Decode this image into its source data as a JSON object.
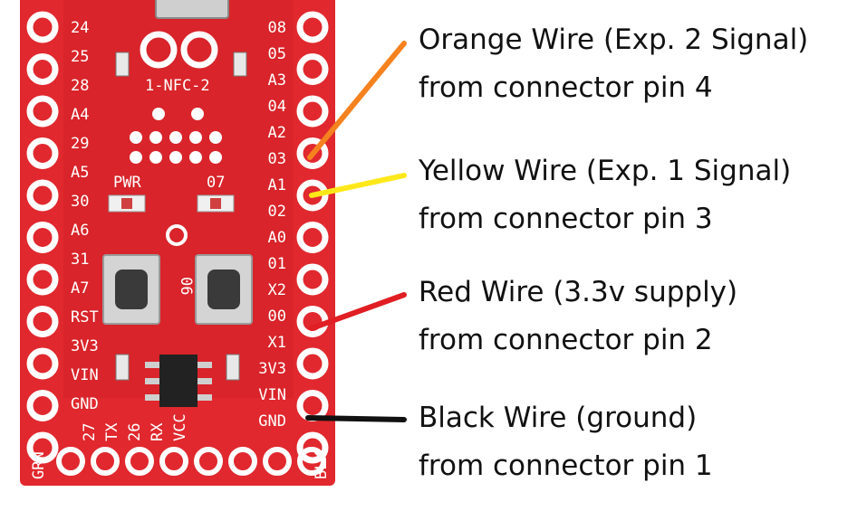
{
  "colors": {
    "board": "#e0282e",
    "board_dark": "#c41d23",
    "pad": "#ffffff",
    "orange_wire": "#f5821f",
    "yellow_wire": "#ffe81a",
    "red_wire": "#e01e23",
    "black_wire": "#111111"
  },
  "board": {
    "left_pins": [
      "24",
      "25",
      "28",
      "A4",
      "29",
      "A5",
      "30",
      "A6",
      "31",
      "A7",
      "RST",
      "3V3",
      "VIN",
      "GND"
    ],
    "right_pins": [
      "08",
      "05",
      "A3",
      "04",
      "A2",
      "03",
      "A1",
      "02",
      "A0",
      "01",
      "X2",
      "00",
      "X1",
      "3V3",
      "VIN",
      "GND"
    ],
    "bottom_pins": [
      "27",
      "TX",
      "26",
      "RX",
      "VCC"
    ],
    "corner_left": "GRN",
    "corner_right": "BLK",
    "nfc_label": "1-NFC-2",
    "pwr_label": "PWR",
    "led_label": "07",
    "button_label": "06"
  },
  "wires": [
    {
      "color": "orange",
      "title": "Orange Wire (Exp. 2 Signal)",
      "detail": "from connector pin 4"
    },
    {
      "color": "yellow",
      "title": "Yellow Wire (Exp. 1 Signal)",
      "detail": "from connector pin 3"
    },
    {
      "color": "red",
      "title": "Red Wire (3.3v supply)",
      "detail": "from connector pin 2"
    },
    {
      "color": "black",
      "title": "Black Wire (ground)",
      "detail": "from connector pin 1"
    }
  ]
}
